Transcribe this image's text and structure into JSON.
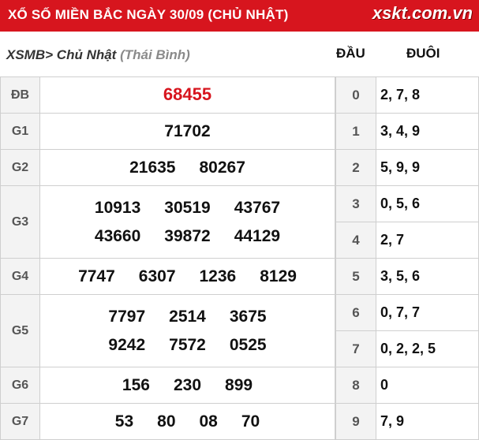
{
  "header": {
    "title": "XỔ SỐ MIỀN BẮC NGÀY 30/09 (CHỦ NHẬT)",
    "logo": "xskt.com.vn"
  },
  "breadcrumb": {
    "code": "XSMB",
    "sep": ">",
    "day": "Chủ Nhật",
    "province": "(Thái Bình)"
  },
  "loto_head": {
    "dau": "ĐẦU",
    "duoi": "ĐUÔI"
  },
  "results": [
    {
      "label": "ĐB",
      "lines": [
        [
          "68455"
        ]
      ]
    },
    {
      "label": "G1",
      "lines": [
        [
          "71702"
        ]
      ]
    },
    {
      "label": "G2",
      "lines": [
        [
          "21635",
          "80267"
        ]
      ]
    },
    {
      "label": "G3",
      "lines": [
        [
          "10913",
          "30519",
          "43767"
        ],
        [
          "43660",
          "39872",
          "44129"
        ]
      ]
    },
    {
      "label": "G4",
      "lines": [
        [
          "7747",
          "6307",
          "1236",
          "8129"
        ]
      ]
    },
    {
      "label": "G5",
      "lines": [
        [
          "7797",
          "2514",
          "3675"
        ],
        [
          "9242",
          "7572",
          "0525"
        ]
      ]
    },
    {
      "label": "G6",
      "lines": [
        [
          "156",
          "230",
          "899"
        ]
      ]
    },
    {
      "label": "G7",
      "lines": [
        [
          "53",
          "80",
          "08",
          "70"
        ]
      ]
    }
  ],
  "loto": [
    {
      "dau": "0",
      "duoi": "2, 7, 8"
    },
    {
      "dau": "1",
      "duoi": "3, 4, 9"
    },
    {
      "dau": "2",
      "duoi": "5, 9, 9"
    },
    {
      "dau": "3",
      "duoi": "0, 5, 6"
    },
    {
      "dau": "4",
      "duoi": "2, 7"
    },
    {
      "dau": "5",
      "duoi": "3, 5, 6"
    },
    {
      "dau": "6",
      "duoi": "0, 7, 7"
    },
    {
      "dau": "7",
      "duoi": "0, 2, 2, 5"
    },
    {
      "dau": "8",
      "duoi": "0"
    },
    {
      "dau": "9",
      "duoi": "7, 9"
    }
  ],
  "colors": {
    "header_bg": "#d7151e",
    "special_prize": "#d7151e"
  }
}
